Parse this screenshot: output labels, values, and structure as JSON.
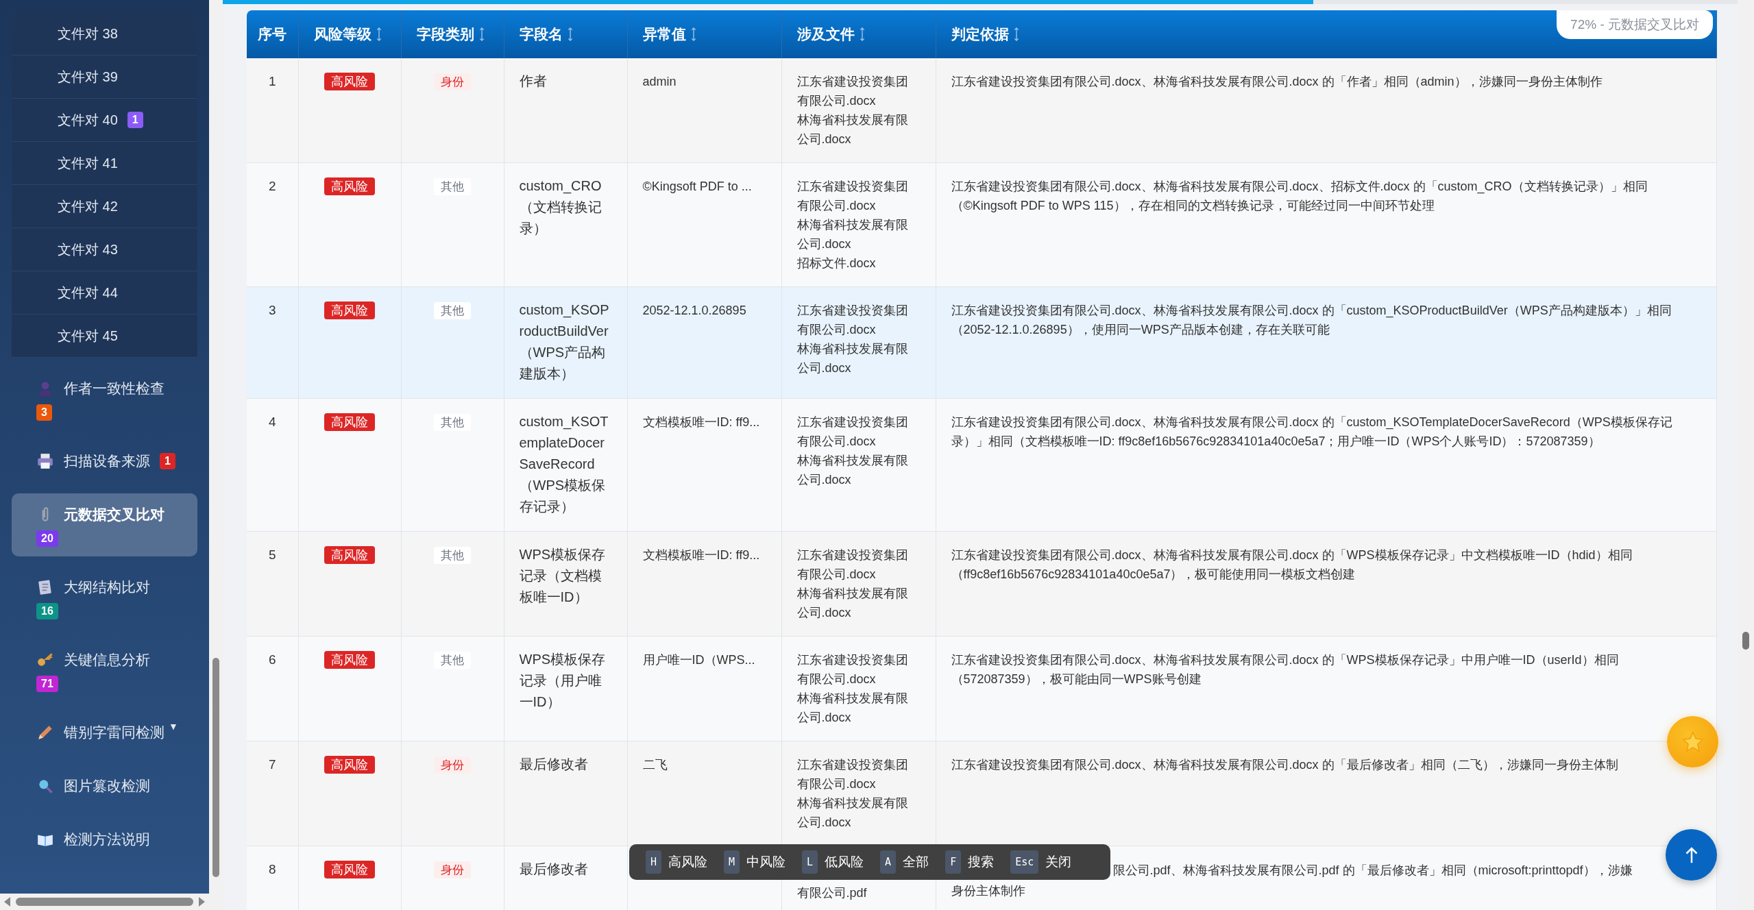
{
  "sidebar": {
    "file_pairs": [
      {
        "label": "文件对 38"
      },
      {
        "label": "文件对 39"
      },
      {
        "label": "文件对 40",
        "badge": "1",
        "color": "#8b5cf6"
      },
      {
        "label": "文件对 41"
      },
      {
        "label": "文件对 42"
      },
      {
        "label": "文件对 43"
      },
      {
        "label": "文件对 44"
      },
      {
        "label": "文件对 45"
      }
    ],
    "nav": [
      {
        "label": "作者一致性检查",
        "badge": "3",
        "color": "#ea580c",
        "kind": "badge_below",
        "selected": false
      },
      {
        "label": "扫描设备来源",
        "badge": "1",
        "color": "#dc2626",
        "kind": "badge_inline",
        "selected": false
      },
      {
        "label": "元数据交叉比对",
        "badge": "20",
        "color": "#7c3aed",
        "kind": "badge_below",
        "selected": true
      },
      {
        "label": "大纲结构比对",
        "badge": "16",
        "color": "#0d9488",
        "kind": "badge_below",
        "selected": false
      },
      {
        "label": "关键信息分析",
        "badge": "71",
        "color": "#c026d3",
        "kind": "badge_below",
        "selected": false
      },
      {
        "label": "错别字雷同检测",
        "toggle": "▼",
        "selected": false
      },
      {
        "label": "图片篡改检测",
        "selected": false
      },
      {
        "label": "检测方法说明",
        "selected": false
      }
    ]
  },
  "progress": {
    "level": 0.72,
    "label": "72% - 元数据交叉比对"
  },
  "table": {
    "columns": [
      {
        "label": "序号",
        "sortable": false
      },
      {
        "label": "风险等级",
        "sortable": true
      },
      {
        "label": "字段类别",
        "sortable": true
      },
      {
        "label": "字段名",
        "sortable": true
      },
      {
        "label": "异常值",
        "sortable": true
      },
      {
        "label": "涉及文件",
        "sortable": true
      },
      {
        "label": "判定依据",
        "sortable": true
      }
    ],
    "rows": [
      {
        "index": "1",
        "selected": false,
        "risk": {
          "text": "高风险",
          "kind": "high"
        },
        "category": {
          "text": "身份",
          "kind": "identity"
        },
        "field": "作者",
        "value": "admin",
        "files": [
          "江东省建设投资集团",
          "有限公司.docx",
          "林海省科技发展有限",
          "公司.docx"
        ],
        "basis": "江东省建设投资集团有限公司.docx、林海省科技发展有限公司.docx 的「作者」相同（admin），涉嫌同一身份主体制作"
      },
      {
        "index": "2",
        "selected": false,
        "risk": {
          "text": "高风险",
          "kind": "high"
        },
        "category": {
          "text": "其他",
          "kind": "other"
        },
        "field": "custom_CRO（文档转换记录）",
        "value": "©Kingsoft PDF to ...",
        "files": [
          "江东省建设投资集团",
          "有限公司.docx",
          "林海省科技发展有限",
          "公司.docx",
          "招标文件.docx"
        ],
        "basis": "江东省建设投资集团有限公司.docx、林海省科技发展有限公司.docx、招标文件.docx 的「custom_CRO（文档转换记录）」相同（©Kingsoft PDF to WPS 115），存在相同的文档转换记录，可能经过同一中间环节处理"
      },
      {
        "index": "3",
        "selected": true,
        "risk": {
          "text": "高风险",
          "kind": "high"
        },
        "category": {
          "text": "其他",
          "kind": "other"
        },
        "field": "custom_KSOProductBuildVer（WPS产品构建版本）",
        "value": "2052-12.1.0.26895",
        "files": [
          "江东省建设投资集团",
          "有限公司.docx",
          "林海省科技发展有限",
          "公司.docx"
        ],
        "basis": "江东省建设投资集团有限公司.docx、林海省科技发展有限公司.docx 的「custom_KSOProductBuildVer（WPS产品构建版本）」相同（2052-12.1.0.26895），使用同一WPS产品版本创建，存在关联可能"
      },
      {
        "index": "4",
        "selected": false,
        "risk": {
          "text": "高风险",
          "kind": "high"
        },
        "category": {
          "text": "其他",
          "kind": "other"
        },
        "field": "custom_KSOTemplateDocerSaveRecord（WPS模板保存记录）",
        "value": "文档模板唯一ID: ff9...",
        "files": [
          "江东省建设投资集团",
          "有限公司.docx",
          "林海省科技发展有限",
          "公司.docx"
        ],
        "basis": "江东省建设投资集团有限公司.docx、林海省科技发展有限公司.docx 的「custom_KSOTemplateDocerSaveRecord（WPS模板保存记录）」相同（文档模板唯一ID: ff9c8ef16b5676c92834101a40c0e5a7；用户唯一ID（WPS个人账号ID）：572087359）"
      },
      {
        "index": "5",
        "selected": false,
        "risk": {
          "text": "高风险",
          "kind": "high"
        },
        "category": {
          "text": "其他",
          "kind": "other"
        },
        "field": "WPS模板保存记录（文档模板唯一ID）",
        "value": "文档模板唯一ID: ff9...",
        "files": [
          "江东省建设投资集团",
          "有限公司.docx",
          "林海省科技发展有限",
          "公司.docx"
        ],
        "basis": "江东省建设投资集团有限公司.docx、林海省科技发展有限公司.docx 的「WPS模板保存记录」中文档模板唯一ID（hdid）相同（ff9c8ef16b5676c92834101a40c0e5a7），极可能使用同一模板文档创建"
      },
      {
        "index": "6",
        "selected": false,
        "risk": {
          "text": "高风险",
          "kind": "high"
        },
        "category": {
          "text": "其他",
          "kind": "other"
        },
        "field": "WPS模板保存记录（用户唯一ID）",
        "value": "用户唯一ID（WPS...",
        "files": [
          "江东省建设投资集团",
          "有限公司.docx",
          "林海省科技发展有限",
          "公司.docx"
        ],
        "basis": "江东省建设投资集团有限公司.docx、林海省科技发展有限公司.docx 的「WPS模板保存记录」中用户唯一ID（userId）相同（572087359），极可能由同一WPS账号创建"
      },
      {
        "index": "7",
        "selected": false,
        "risk": {
          "text": "高风险",
          "kind": "high"
        },
        "category": {
          "text": "身份",
          "kind": "identity"
        },
        "field": "最后修改者",
        "value": "二飞",
        "files": [
          "江东省建设投资集团",
          "有限公司.docx",
          "林海省科技发展有限",
          "公司.docx"
        ],
        "basis": "江东省建设投资集团有限公司.docx、林海省科技发展有限公司.docx 的「最后修改者」相同（二飞），涉嫌同一身份主体制"
      },
      {
        "index": "8",
        "selected": false,
        "covered_first_line": true,
        "risk": {
          "text": "高风险",
          "kind": "high"
        },
        "category": {
          "text": "身份",
          "kind": "identity"
        },
        "field": "最后修改者",
        "files": [
          "有限公司.pdf"
        ],
        "basis_tail": "限公司.pdf、林海省科技发展有限公司.pdf 的「最后修改者」相同（microsoft:printtopdf），涉嫌",
        "basis": "身份主体制作"
      }
    ]
  },
  "shortcuts": [
    {
      "key": "H",
      "label": "高风险"
    },
    {
      "key": "M",
      "label": "中风险"
    },
    {
      "key": "L",
      "label": "低风险"
    },
    {
      "key": "A",
      "label": "全部"
    },
    {
      "key": "F",
      "label": "搜索"
    },
    {
      "key": "Esc",
      "label": "关闭"
    }
  ]
}
